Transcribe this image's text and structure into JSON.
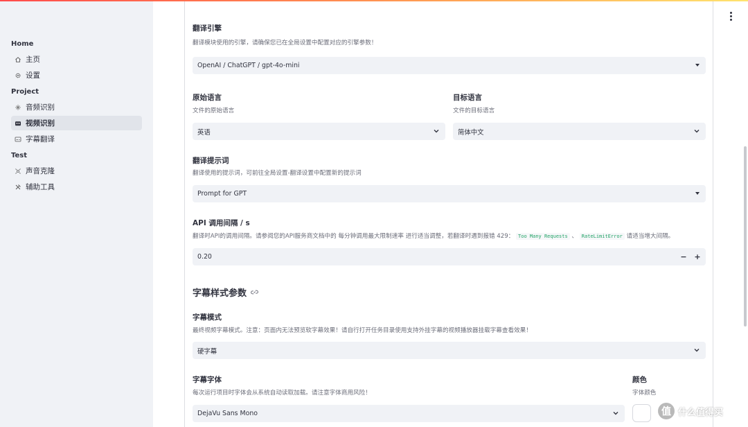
{
  "top_menu": {
    "icon": "kebab-menu-icon"
  },
  "sidebar": {
    "sections": [
      {
        "title": "Home",
        "items": [
          {
            "label": "主页",
            "icon": "home-icon"
          },
          {
            "label": "设置",
            "icon": "gear-icon"
          }
        ]
      },
      {
        "title": "Project",
        "items": [
          {
            "label": "音频识别",
            "icon": "audio-icon"
          },
          {
            "label": "视频识别",
            "icon": "video-icon",
            "active": true
          },
          {
            "label": "字幕翻译",
            "icon": "subtitle-icon"
          }
        ]
      },
      {
        "title": "Test",
        "items": [
          {
            "label": "声音克隆",
            "icon": "voice-clone-icon"
          },
          {
            "label": "辅助工具",
            "icon": "tools-icon"
          }
        ]
      }
    ]
  },
  "form": {
    "engine": {
      "label": "翻译引擎",
      "help": "翻译模块使用的引擎，请确保您已在全局设置中配置对应的引擎参数！",
      "value": "OpenAI / ChatGPT / gpt-4o-mini"
    },
    "source_lang": {
      "label": "原始语言",
      "help": "文件的原始语言",
      "value": "英语"
    },
    "target_lang": {
      "label": "目标语言",
      "help": "文件的目标语言",
      "value": "简体中文"
    },
    "prompt": {
      "label": "翻译提示词",
      "help": "翻译使用的提示词，可前往全局设置-翻译设置中配置新的提示词",
      "value": "Prompt for GPT"
    },
    "api_interval": {
      "label": "API 调用间隔 / s",
      "help_prefix": "翻译时API的调用间隔。请参阅您的API服务商文档中的 每分钟调用最大限制速率 进行适当调整，若翻译时遇到报错 429：",
      "code1": "Too Many Requests",
      "separator": "、",
      "code2": "RateLimitError",
      "help_suffix": "请适当增大间隔。",
      "value": "0.20",
      "minus": "−",
      "plus": "+"
    },
    "subtitle_section": {
      "title": "字幕样式参数",
      "icon": "link-icon"
    },
    "subtitle_mode": {
      "label": "字幕模式",
      "help": "最终视频字幕模式。注意：页面内无法预览软字幕效果！请自行打开任务目录使用支持外挂字幕的视频播放器挂载字幕查看效果！",
      "value": "硬字幕"
    },
    "subtitle_font": {
      "label": "字幕字体",
      "help": "每次运行项目时字体会从系统自动读取加载。请注意字体商用风险！",
      "value": "DejaVu Sans Mono"
    },
    "color": {
      "label": "颜色",
      "help": "字体颜色",
      "value": "#ffffff"
    }
  },
  "watermark": {
    "logo": "值",
    "text": "什么值得买"
  }
}
